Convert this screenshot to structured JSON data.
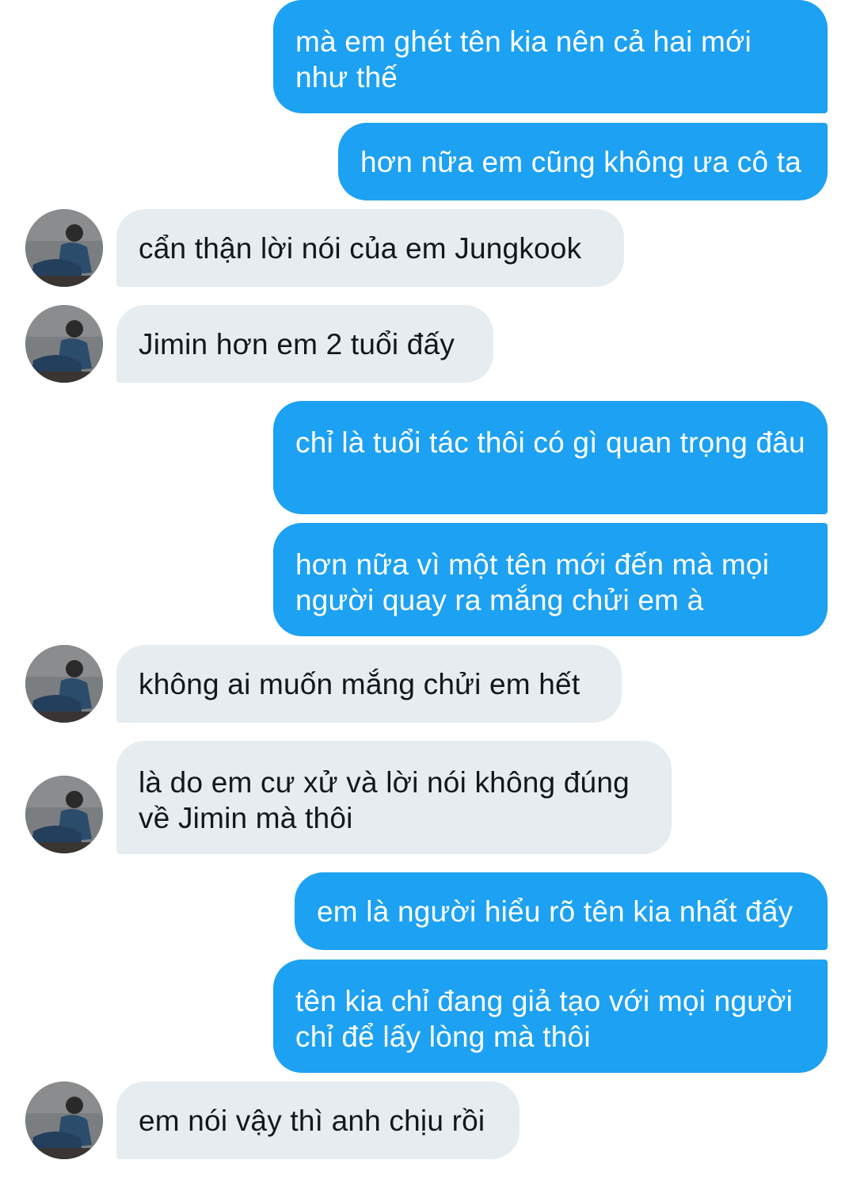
{
  "conversation": {
    "messages": [
      {
        "from": "me",
        "text": "mà em ghét tên kia nên cả hai mới như thế"
      },
      {
        "from": "me",
        "text": "hơn nữa em cũng không ưa cô ta"
      },
      {
        "from": "them",
        "text": "cẩn thận lời nói của em Jungkook"
      },
      {
        "from": "them",
        "text": "Jimin hơn em 2 tuổi đấy"
      },
      {
        "from": "me",
        "text": "chỉ là tuổi tác thôi có gì quan trọng đâu"
      },
      {
        "from": "me",
        "text": "hơn nữa vì một tên mới đến mà mọi người quay ra mắng chửi em à"
      },
      {
        "from": "them",
        "text": "không ai muốn mắng chửi em hết"
      },
      {
        "from": "them",
        "text": "là do em cư xử và lời nói không đúng về Jimin mà thôi"
      },
      {
        "from": "me",
        "text": "em là người hiểu rõ tên kia nhất đấy"
      },
      {
        "from": "me",
        "text": "tên kia chỉ đang giả tạo với mọi người chỉ để lấy lòng mà thôi"
      },
      {
        "from": "them",
        "text": "em nói vậy thì anh chịu rồi"
      }
    ]
  },
  "colors": {
    "sent_bubble": "#1da1f2",
    "sent_text": "#ffffff",
    "received_bubble": "#e6ecf0",
    "received_text": "#14171a",
    "background": "#ffffff"
  },
  "icons": {
    "contact_avatar": "avatar"
  }
}
